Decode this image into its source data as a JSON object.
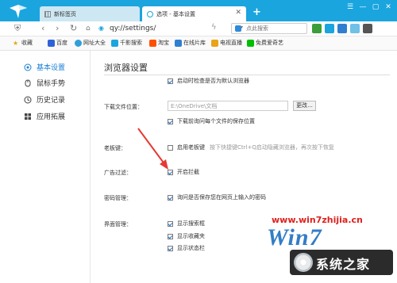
{
  "tabs": [
    {
      "label": "新标签页",
      "icon": "grid-page-icon",
      "active": false
    },
    {
      "label": "选项 - 基本设置",
      "icon": "settings-page-icon",
      "active": true
    }
  ],
  "window_controls": [
    "minimize",
    "maximize",
    "close"
  ],
  "address": {
    "url": "qy://settings/"
  },
  "search": {
    "placeholder": "点此搜索"
  },
  "bookmarks": [
    {
      "label": "收藏",
      "icon": "star-icon"
    },
    {
      "label": "百度",
      "icon": "baidu-icon"
    },
    {
      "label": "网址大全",
      "icon": "globe-icon"
    },
    {
      "label": "千影搜索",
      "icon": "search-icon"
    },
    {
      "label": "淘宝",
      "icon": "taobao-icon"
    },
    {
      "label": "在线片库",
      "icon": "film-icon"
    },
    {
      "label": "电视直播",
      "icon": "tv-icon"
    },
    {
      "label": "免费爱奇艺",
      "icon": "iqiyi-icon"
    }
  ],
  "sidebar": {
    "items": [
      {
        "label": "基本设置",
        "icon": "gear-circle-icon",
        "active": true
      },
      {
        "label": "鼠标手势",
        "icon": "mouse-icon",
        "active": false
      },
      {
        "label": "历史记录",
        "icon": "clock-icon",
        "active": false
      },
      {
        "label": "应用拓展",
        "icon": "apps-icon",
        "active": false
      }
    ]
  },
  "content": {
    "title": "浏览器设置",
    "default_browser": {
      "label": "启动时检查是否为默认浏览器",
      "checked": true
    },
    "download": {
      "label": "下载文件位置：",
      "path": "E:\\OneDrive\\文档",
      "change_button": "更改...",
      "ask_each": {
        "label": "下载前询问每个文件的保存位置",
        "checked": true
      }
    },
    "boss_key": {
      "label": "老板键：",
      "option": {
        "label": "启用老板键",
        "checked": false
      },
      "hint": "按下快捷键Ctrl+Q启动隐藏浏览器，再次按下恢复"
    },
    "ad_filter": {
      "label": "广告过滤：",
      "option": {
        "label": "开启拦截",
        "checked": true
      }
    },
    "password": {
      "label": "密码管理：",
      "option": {
        "label": "询问是否保存您在网页上输入的密码",
        "checked": true
      }
    },
    "interface": {
      "label": "界面管理：",
      "options": [
        {
          "label": "显示搜索框",
          "checked": true
        },
        {
          "label": "显示收藏夹",
          "checked": true
        },
        {
          "label": "显示状态栏",
          "checked": true
        }
      ]
    }
  },
  "watermark": {
    "url": "www.win7zhijia.cn",
    "logo_text": "Win7",
    "badge_text": "系统之家"
  },
  "colors": {
    "titlebar": "#1aa5de",
    "accent": "#1a7fd4",
    "annotation_arrow": "#e53935"
  }
}
